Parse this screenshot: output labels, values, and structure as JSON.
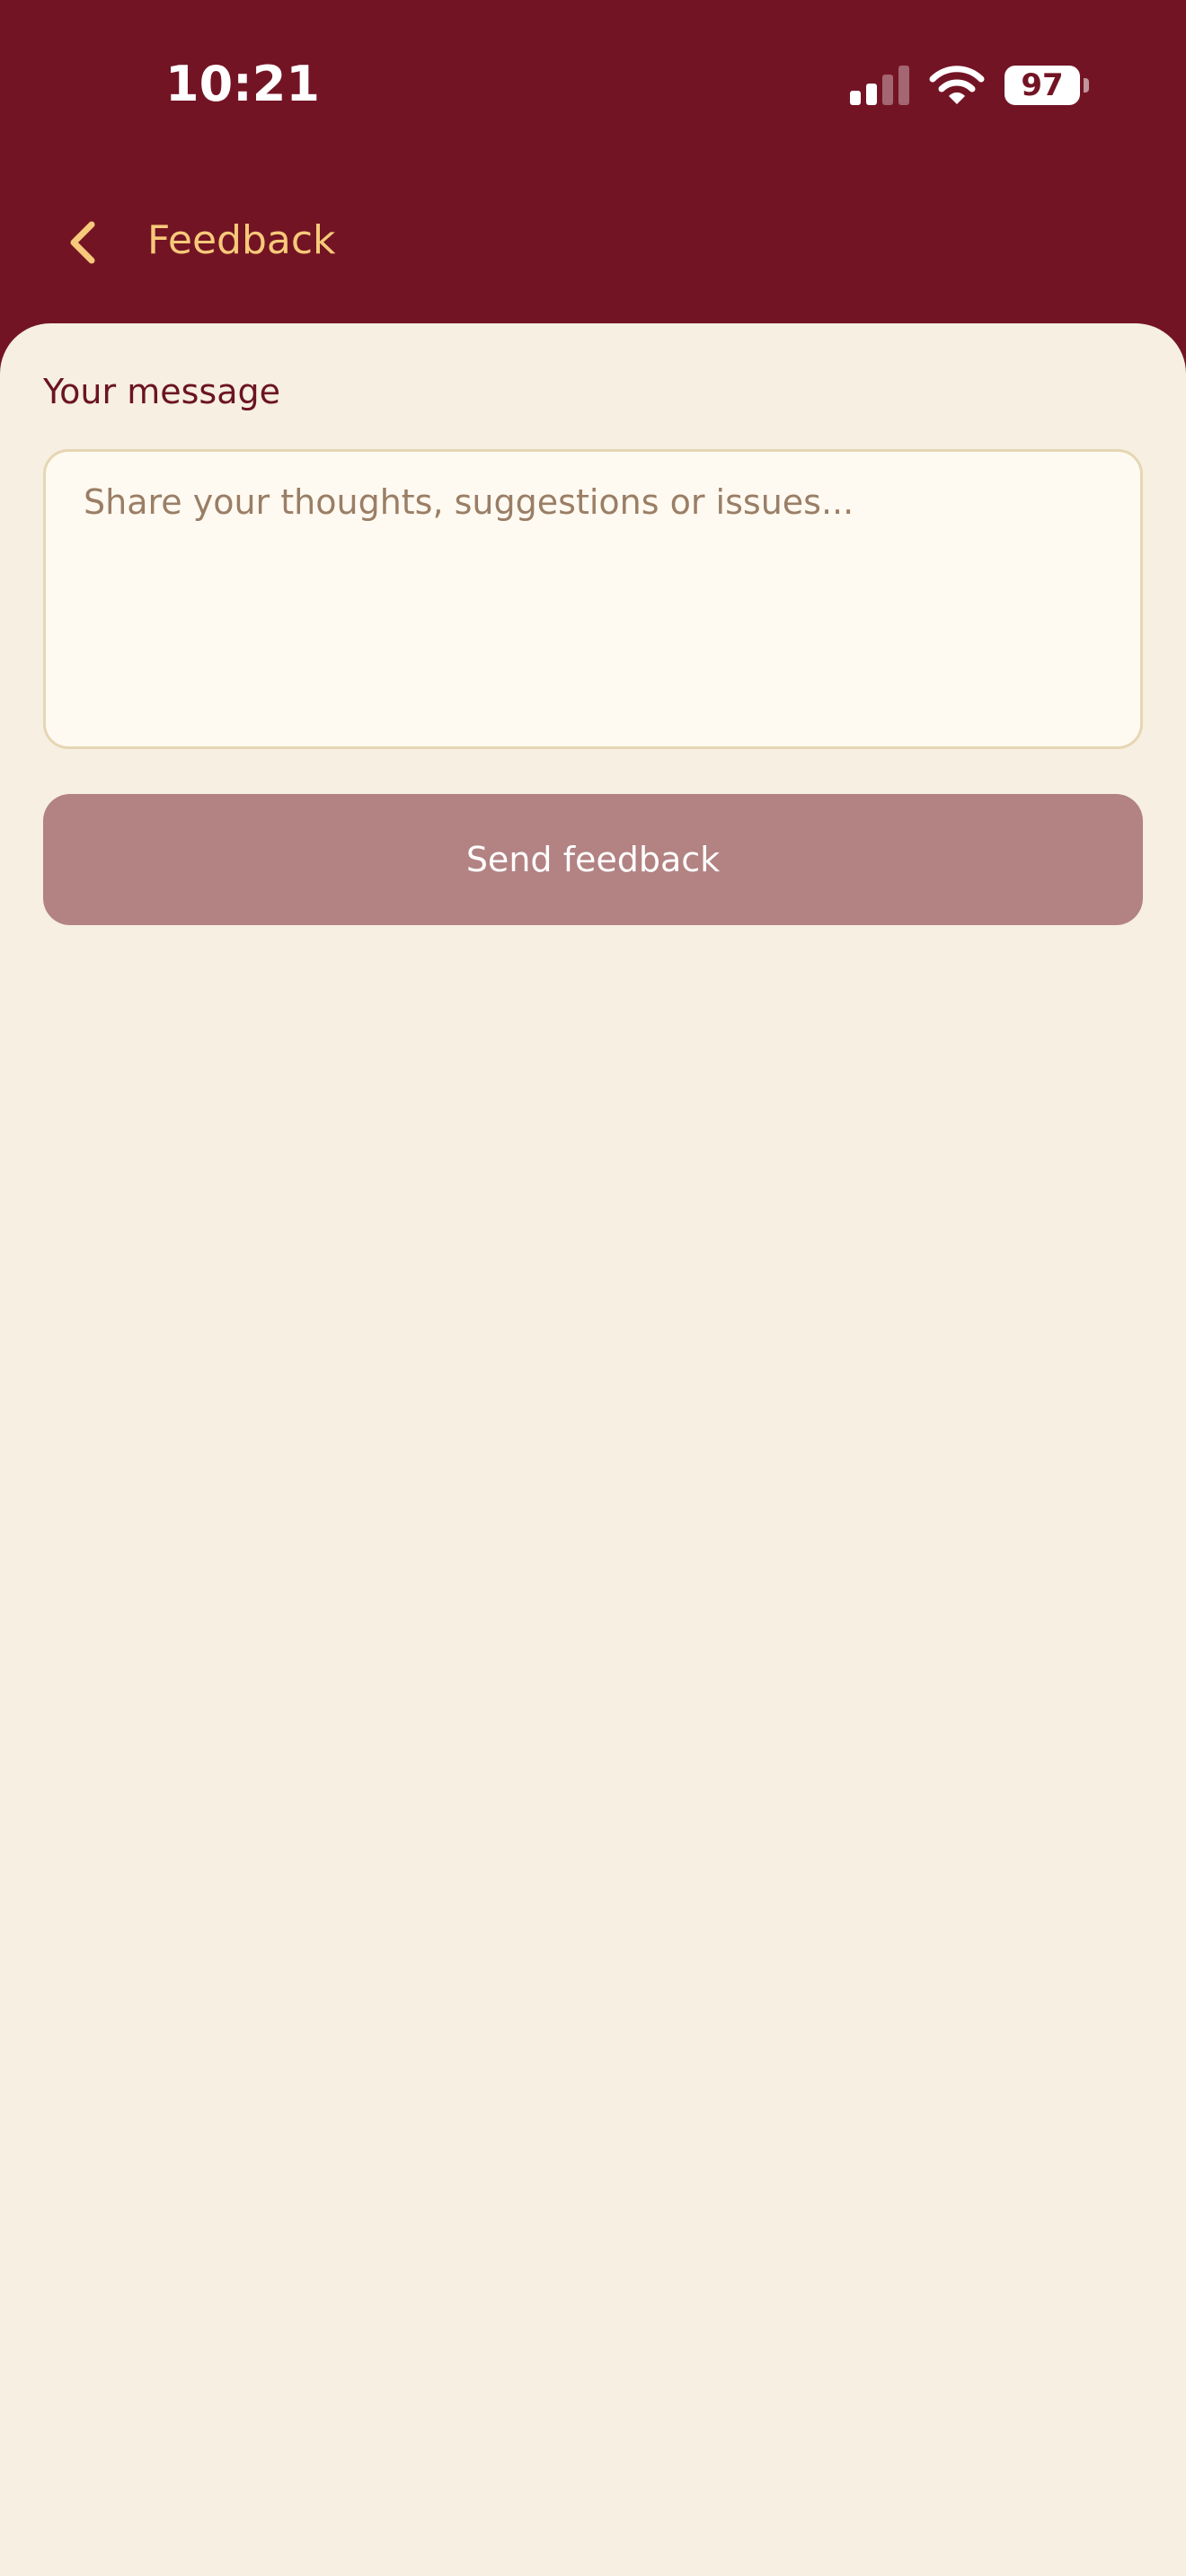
{
  "status_bar": {
    "time": "10:21",
    "battery": "97",
    "icons": [
      "signal-icon",
      "wifi-icon",
      "battery-icon"
    ]
  },
  "header": {
    "title": "Feedback",
    "back_icon": "chevron-left-icon"
  },
  "form": {
    "label": "Your message",
    "message_value": "",
    "message_placeholder": "Share your thoughts, suggestions or issues...",
    "submit_label": "Send feedback"
  },
  "colors": {
    "header_background": "#731424",
    "accent": "#f7c97a",
    "content_background": "#f6efe2",
    "button_disabled": "#b38282"
  }
}
